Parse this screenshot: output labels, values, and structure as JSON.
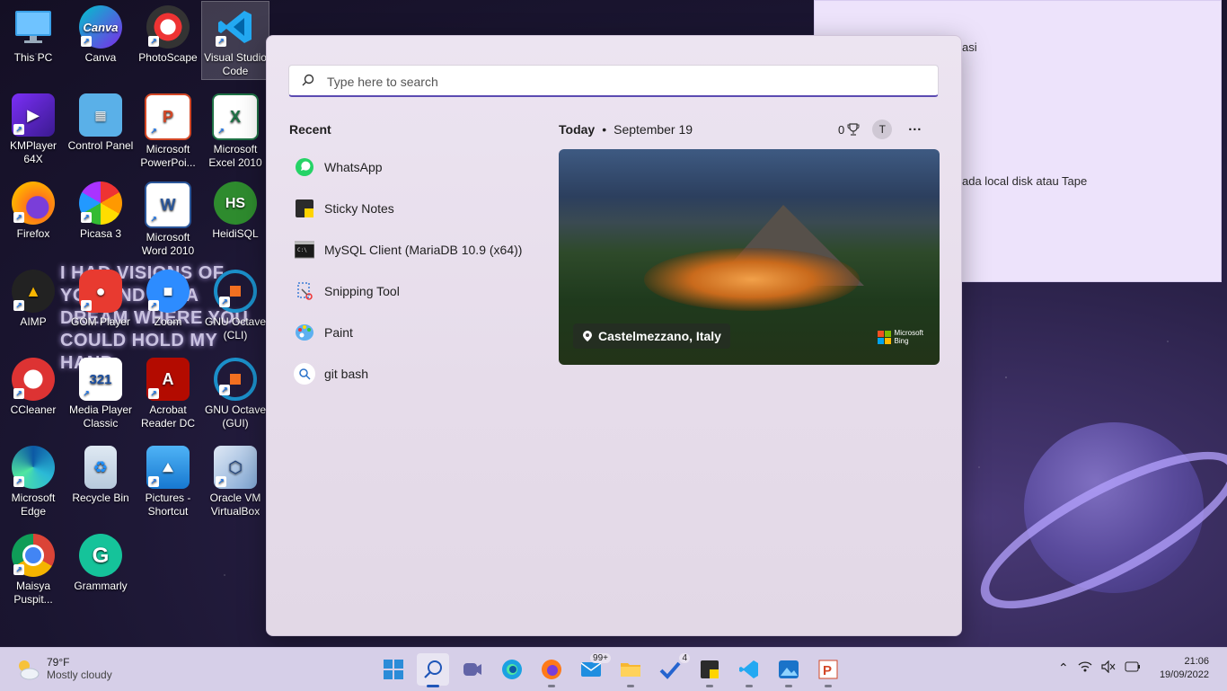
{
  "desktop": {
    "icons": [
      {
        "label": "This PC"
      },
      {
        "label": "Canva"
      },
      {
        "label": "PhotoScape"
      },
      {
        "label": "Visual Studio Code"
      },
      {
        "label": "KMPlayer 64X"
      },
      {
        "label": "Control Panel"
      },
      {
        "label": "Microsoft PowerPoi..."
      },
      {
        "label": "Microsoft Excel 2010"
      },
      {
        "label": "Firefox"
      },
      {
        "label": "Picasa 3"
      },
      {
        "label": "Microsoft Word 2010"
      },
      {
        "label": "HeidiSQL"
      },
      {
        "label": "AIMP"
      },
      {
        "label": "GOM Player"
      },
      {
        "label": "Zoom"
      },
      {
        "label": "GNU Octave (CLI)"
      },
      {
        "label": "CCleaner"
      },
      {
        "label": "Media Player Classic"
      },
      {
        "label": "Acrobat Reader DC"
      },
      {
        "label": "GNU Octave (GUI)"
      },
      {
        "label": "Microsoft Edge"
      },
      {
        "label": "Recycle Bin"
      },
      {
        "label": "Pictures - Shortcut"
      },
      {
        "label": "Oracle VM VirtualBox"
      },
      {
        "label": "Maisya Puspit..."
      },
      {
        "label": "Grammarly"
      }
    ],
    "wallpaper_text": "I HAD VISIONS OF YOU AND I IN A DREAM WHERE YOU COULD HOLD MY HAND",
    "sticky_lines": [
      "asi",
      "ada local disk atau Tape"
    ]
  },
  "search": {
    "placeholder": "Type here to search"
  },
  "recent": {
    "heading": "Recent",
    "items": [
      {
        "label": "WhatsApp"
      },
      {
        "label": "Sticky Notes"
      },
      {
        "label": "MySQL Client (MariaDB 10.9 (x64))"
      },
      {
        "label": "Snipping Tool"
      },
      {
        "label": "Paint"
      },
      {
        "label": "git bash"
      }
    ]
  },
  "today": {
    "label": "Today",
    "date": "September 19",
    "points": "0",
    "avatar": "T",
    "more": "···"
  },
  "bing": {
    "location": "Castelmezzano, Italy",
    "brand_line1": "Microsoft",
    "brand_line2": "Bing"
  },
  "taskbar": {
    "weather_temp": "79°F",
    "weather_desc": "Mostly cloudy",
    "mail_badge": "99+",
    "todo_badge": "4",
    "time": "21:06",
    "date": "19/09/2022"
  }
}
